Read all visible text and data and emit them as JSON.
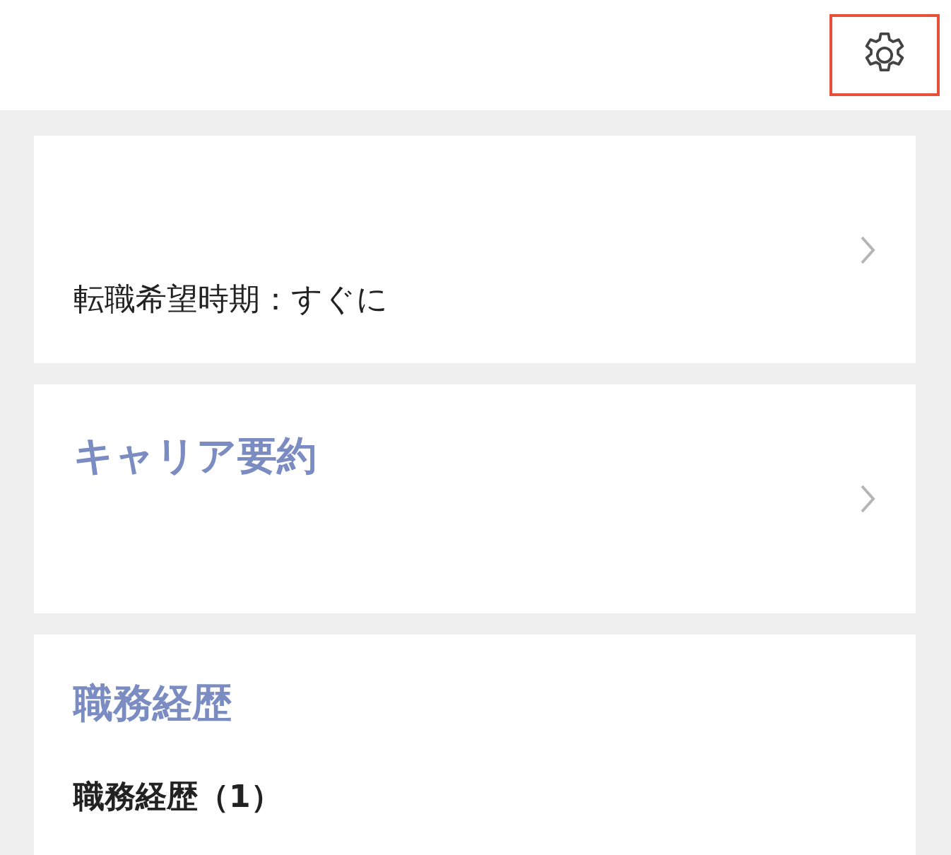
{
  "cards": [
    {
      "kind": "detail",
      "text": "転職希望時期：すぐに",
      "has_chevron": true
    },
    {
      "kind": "section",
      "title": "キャリア要約",
      "has_chevron": true
    },
    {
      "kind": "list",
      "title": "職務経歴",
      "items": [
        "職務経歴（1）"
      ],
      "has_chevron": false
    }
  ]
}
